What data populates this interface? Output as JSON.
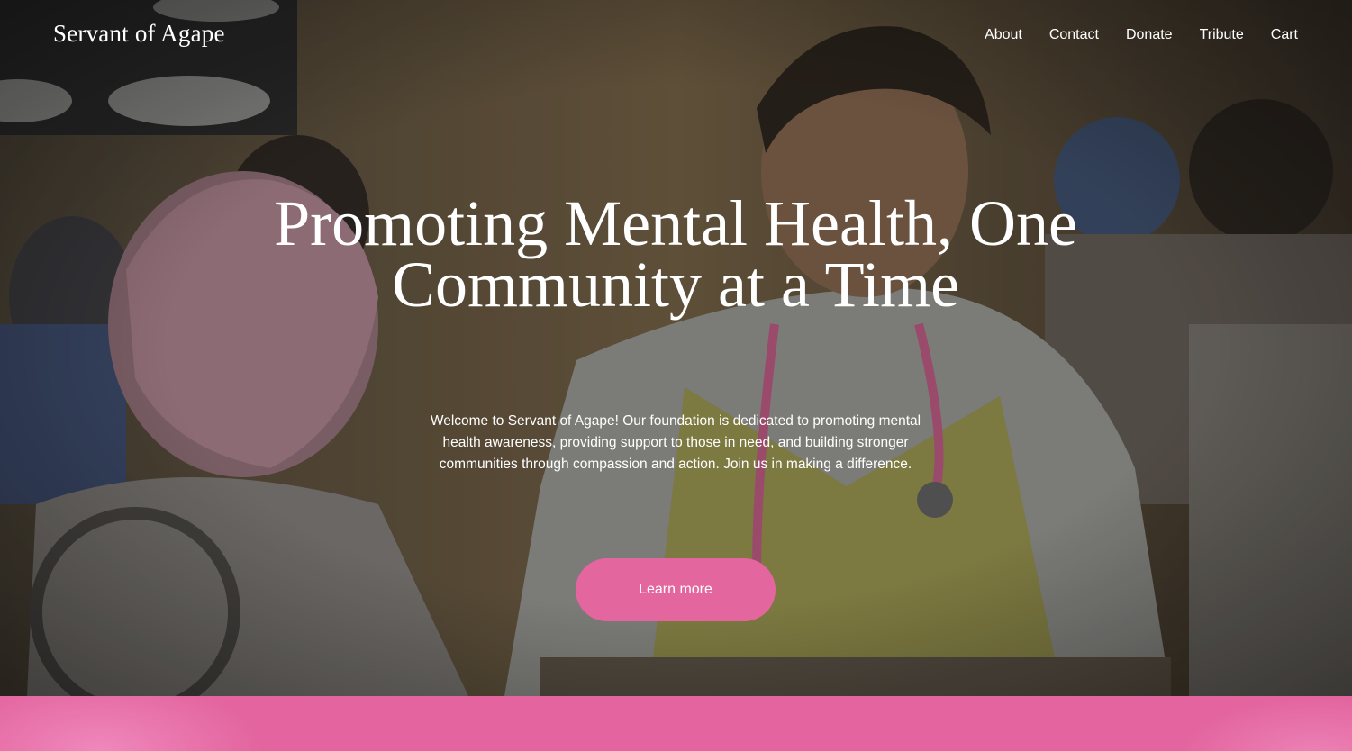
{
  "header": {
    "logo": "Servant of Agape",
    "nav": [
      "About",
      "Contact",
      "Donate",
      "Tribute",
      "Cart"
    ]
  },
  "hero": {
    "headline": "Promoting Mental Health, One Community at a Time",
    "intro": "Welcome to Servant of Agape! Our foundation is dedicated to promoting mental health awareness, providing support to those in need, and building stronger communities through compassion and action. Join us in making a difference.",
    "cta_label": "Learn more"
  },
  "colors": {
    "accent": "#e4669f",
    "text": "#ffffff"
  }
}
